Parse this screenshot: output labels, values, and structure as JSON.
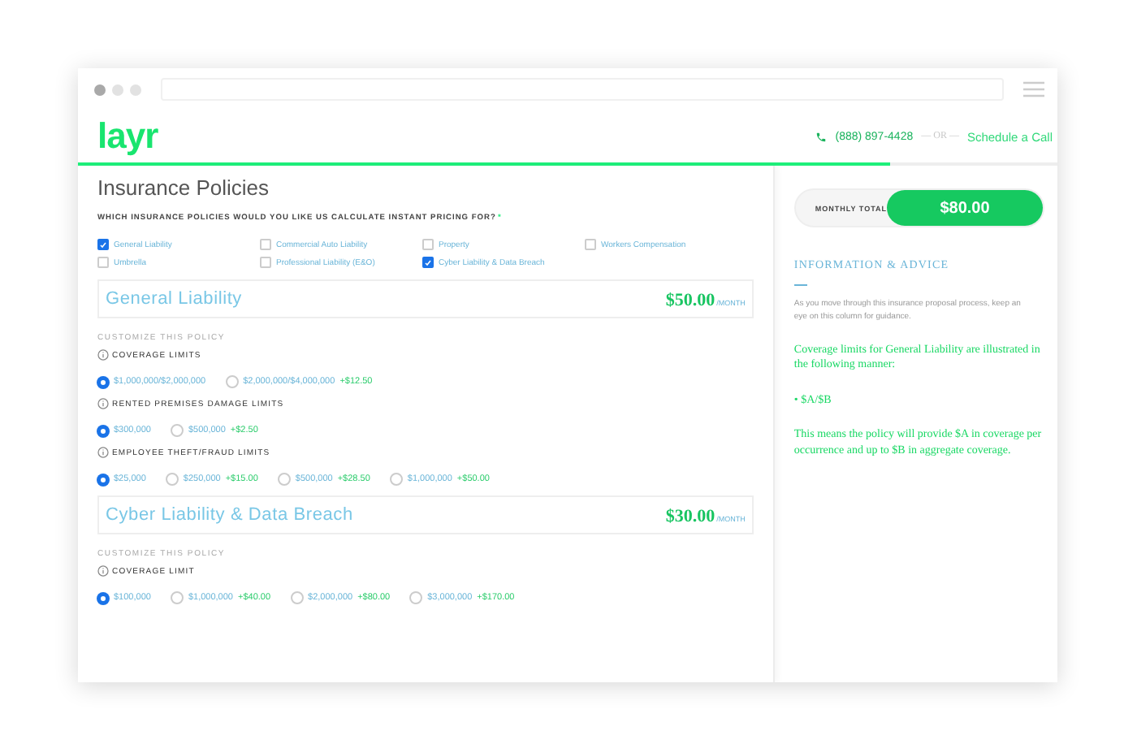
{
  "header": {
    "logo": "layr",
    "phone": "(888) 897-4428",
    "separator": "— OR —",
    "schedule_link": "Schedule a Call",
    "progress": {
      "level": 0.83
    }
  },
  "page_title": "Insurance Policies",
  "question": {
    "text": "WHICH INSURANCE POLICIES WOULD YOU LIKE US CALCULATE INSTANT PRICING FOR?",
    "required_mark": "*"
  },
  "policy_options": [
    {
      "label": "General Liability",
      "checked": true
    },
    {
      "label": "Commercial Auto Liability",
      "checked": false
    },
    {
      "label": "Property",
      "checked": false
    },
    {
      "label": "Workers Compensation",
      "checked": false
    },
    {
      "label": "Umbrella",
      "checked": false
    },
    {
      "label": "Professional Liability (E&O)",
      "checked": false
    },
    {
      "label": "Cyber Liability & Data Breach",
      "checked": true
    }
  ],
  "policies": [
    {
      "name": "General Liability",
      "price": "$50.00",
      "per": "/MONTH",
      "customize_label": "CUSTOMIZE THIS POLICY",
      "limits": [
        {
          "label": "COVERAGE LIMITS",
          "options": [
            {
              "value": "$1,000,000/$2,000,000",
              "selected": true
            },
            {
              "value": "$2,000,000/$4,000,000",
              "surcharge": "+$12.50",
              "selected": false
            }
          ]
        },
        {
          "label": "RENTED PREMISES DAMAGE LIMITS",
          "options": [
            {
              "value": "$300,000",
              "selected": true
            },
            {
              "value": "$500,000",
              "surcharge": "+$2.50",
              "selected": false
            }
          ]
        },
        {
          "label": "EMPLOYEE THEFT/FRAUD LIMITS",
          "options": [
            {
              "value": "$25,000",
              "selected": true
            },
            {
              "value": "$250,000",
              "surcharge": "+$15.00",
              "selected": false
            },
            {
              "value": "$500,000",
              "surcharge": "+$28.50",
              "selected": false
            },
            {
              "value": "$1,000,000",
              "surcharge": "+$50.00",
              "selected": false
            }
          ]
        }
      ]
    },
    {
      "name": "Cyber Liability & Data Breach",
      "price": "$30.00",
      "per": "/MONTH",
      "customize_label": "CUSTOMIZE THIS POLICY",
      "limits": [
        {
          "label": "COVERAGE LIMIT",
          "options": [
            {
              "value": "$100,000",
              "selected": true
            },
            {
              "value": "$1,000,000",
              "surcharge": "+$40.00",
              "selected": false
            },
            {
              "value": "$2,000,000",
              "surcharge": "+$80.00",
              "selected": false
            },
            {
              "value": "$3,000,000",
              "surcharge": "+$170.00",
              "selected": false
            }
          ]
        }
      ]
    }
  ],
  "summary": {
    "label": "MONTHLY TOTAL",
    "total": "$80.00"
  },
  "info": {
    "heading": "INFORMATION & ADVICE",
    "intro": "As you move through this insurance proposal process, keep an eye on this column for guidance.",
    "paragraphs": [
      "Coverage limits for General Liability are illustrated in the following manner:",
      "• $A/$B",
      "This means the policy will provide $A in coverage per occurrence and up to $B in aggregate coverage."
    ]
  }
}
